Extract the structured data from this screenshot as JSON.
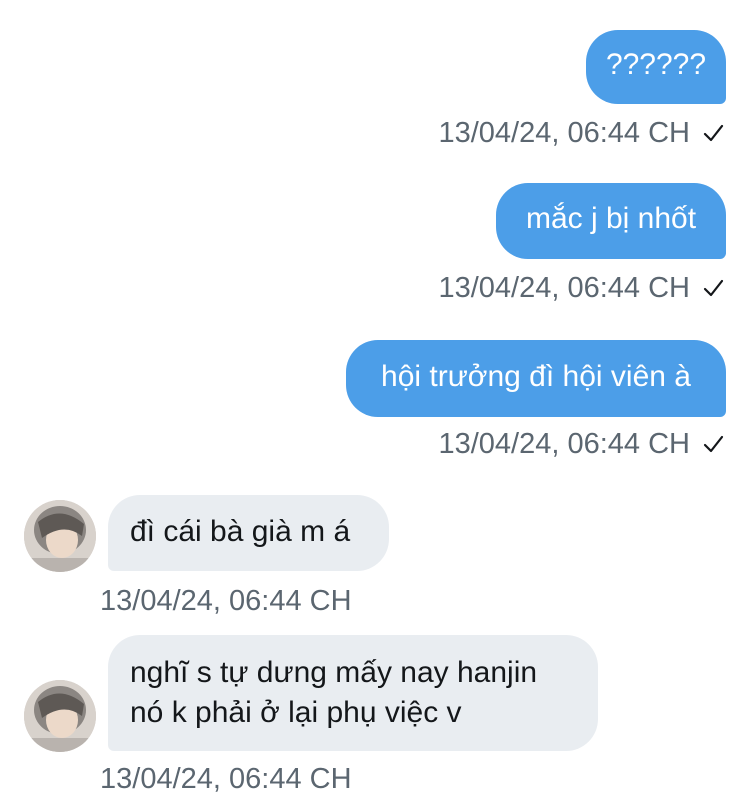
{
  "messages": [
    {
      "direction": "outgoing",
      "text": "??????",
      "timestamp": "13/04/24, 06:44 CH",
      "status_icon": "check-icon"
    },
    {
      "direction": "outgoing",
      "text": "mắc j bị nhốt",
      "timestamp": "13/04/24, 06:44 CH",
      "status_icon": "check-icon"
    },
    {
      "direction": "outgoing",
      "text": "hội trưởng đì hội viên à",
      "timestamp": "13/04/24, 06:44 CH",
      "status_icon": "check-icon"
    },
    {
      "direction": "incoming",
      "text": "đì cái bà già m á",
      "timestamp": "13/04/24, 06:44 CH",
      "avatar": "avatar"
    },
    {
      "direction": "incoming",
      "lines": [
        "nghĩ s tự dưng mấy nay hanjin",
        "nó k phải ở lại phụ việc v"
      ],
      "timestamp": "13/04/24, 06:44 CH",
      "avatar": "avatar"
    }
  ],
  "colors": {
    "outgoing_bubble": "#4c9ee8",
    "incoming_bubble": "#e9edf1",
    "timestamp_text": "#5b6670",
    "background": "#ffffff"
  }
}
